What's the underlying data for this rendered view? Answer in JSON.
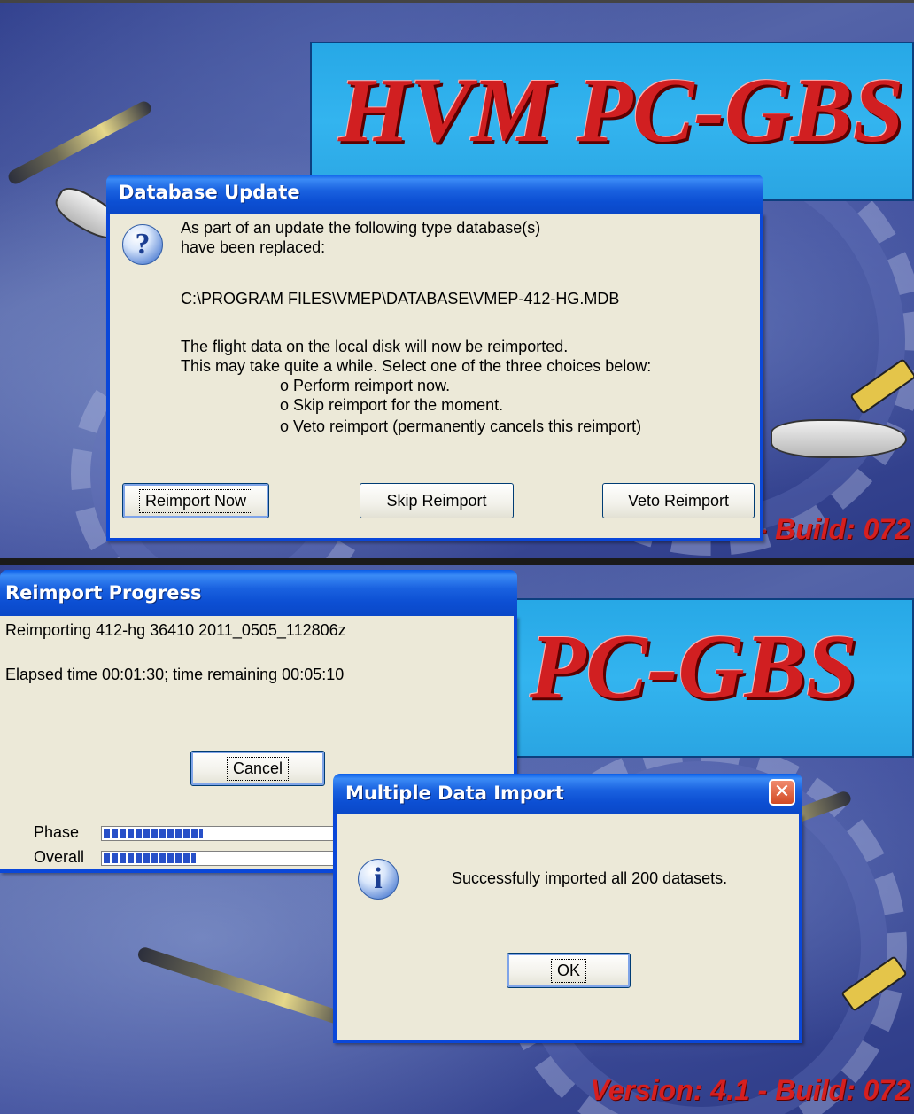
{
  "top_screen": {
    "banner_title": "HVM PC-GBS",
    "version_text": "Version: 4.1 - Build: 072",
    "dialog": {
      "title": "Database Update",
      "icon": "question-icon",
      "lines": [
        "As part of an update the following type database(s)",
        "have been replaced:",
        "C:\\PROGRAM FILES\\VMEP\\DATABASE\\VMEP-412-HG.MDB",
        "The flight data on the local disk will now be reimported.",
        "This may take quite a while. Select one of the three choices below:",
        "o Perform reimport now.",
        "o Skip reimport for the moment.",
        "o Veto reimport (permanently cancels this reimport)"
      ],
      "buttons": [
        "Reimport Now",
        "Skip Reimport",
        "Veto Reimport"
      ]
    }
  },
  "bottom_screen": {
    "banner_title": "PC-GBS",
    "version_text": "Version: 4.1 - Build: 072",
    "progress_dialog": {
      "title": "Reimport Progress",
      "status": "Reimporting 412-hg 36410 2011_0505_112806z",
      "time": "Elapsed time 00:01:30; time remaining 00:05:10",
      "cancel_label": "Cancel",
      "phase_label": "Phase",
      "overall_label": "Overall",
      "phase_progress": 0.41,
      "overall_progress": 0.38
    },
    "message_dialog": {
      "title": "Multiple Data Import",
      "icon": "info-icon",
      "message": "Successfully imported all 200 datasets.",
      "ok_label": "OK",
      "close_glyph": "✕"
    }
  },
  "colors": {
    "xp_blue": "#0a47d9",
    "dialog_face": "#ece9d8",
    "banner_cyan": "#2aa8e6",
    "title_red": "#d11f21",
    "progress_blue": "#2850c8"
  }
}
